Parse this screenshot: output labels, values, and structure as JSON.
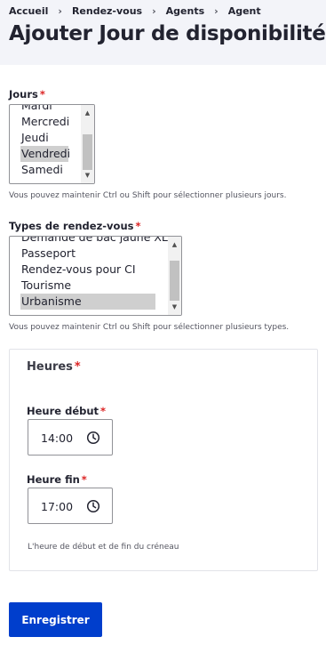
{
  "breadcrumb": [
    "Accueil",
    "Rendez-vous",
    "Agents",
    "Agent"
  ],
  "page": {
    "title": "Ajouter Jour de disponibilité"
  },
  "days": {
    "label": "Jours",
    "options": [
      "Mardi",
      "Mercredi",
      "Jeudi",
      "Vendredi",
      "Samedi"
    ],
    "selected": "Vendredi",
    "help": "Vous pouvez maintenir Ctrl ou Shift pour sélectionner plusieurs jours."
  },
  "types": {
    "label": "Types de rendez-vous",
    "options": [
      "Demande de bac jaune XL",
      "Passeport",
      "Rendez-vous pour CI",
      "Tourisme",
      "Urbanisme"
    ],
    "selected": "Urbanisme",
    "help": "Vous pouvez maintenir Ctrl ou Shift pour sélectionner plusieurs types."
  },
  "hours": {
    "legend": "Heures",
    "start_label": "Heure début",
    "start_value": "14:00",
    "end_label": "Heure fin",
    "end_value": "17:00",
    "help": "L'heure de début et de fin du créneau"
  },
  "required_marker": "*",
  "breadcrumb_separator": "›",
  "submit": {
    "label": "Enregistrer"
  },
  "colors": {
    "primary": "#003ecc",
    "required": "#dc2323",
    "header_bg": "#f3f4f9",
    "selected_option": "#cfcfcf"
  },
  "icons": {
    "time_picker": "clock-icon",
    "scroll_up": "scroll-up-arrow",
    "scroll_down": "scroll-down-arrow"
  }
}
